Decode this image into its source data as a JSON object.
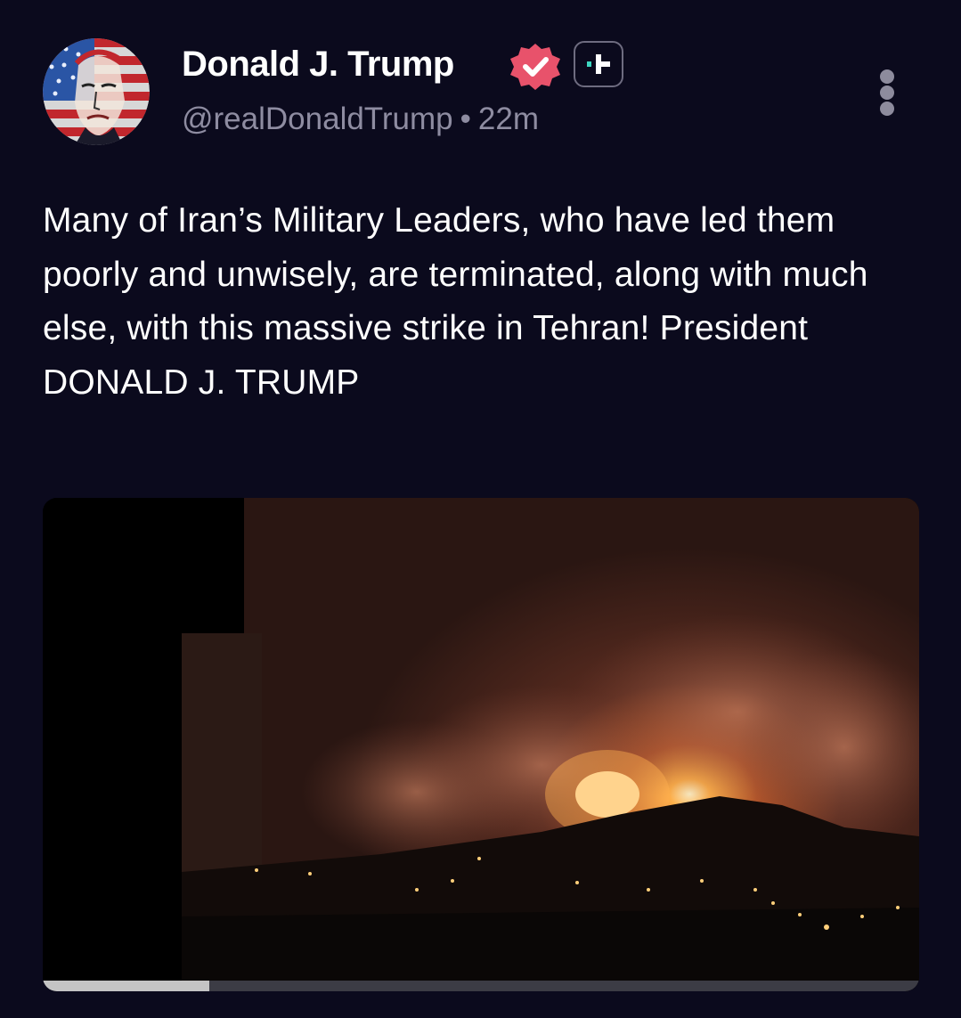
{
  "author": {
    "display_name": "Donald J. Trump",
    "handle": "@realDonaldTrump",
    "time_ago": "22m",
    "separator": "•",
    "verified": true
  },
  "icons": {
    "avatar": "flag-portrait-avatar",
    "verified": "verified-badge-icon",
    "follow": "follow-plus-icon",
    "more": "more-vertical-icon"
  },
  "post": {
    "text": "Many of Iran’s Military Leaders, who have led them poorly and unwisely, are terminated, along with much else, with this massive strike in Tehran! President DONALD J. TRUMP"
  },
  "media": {
    "type": "video",
    "progress_fraction": 0.19
  },
  "colors": {
    "background": "#0b0a1d",
    "verified_badge": "#e8526b",
    "secondary_text": "#8e8ca1"
  }
}
